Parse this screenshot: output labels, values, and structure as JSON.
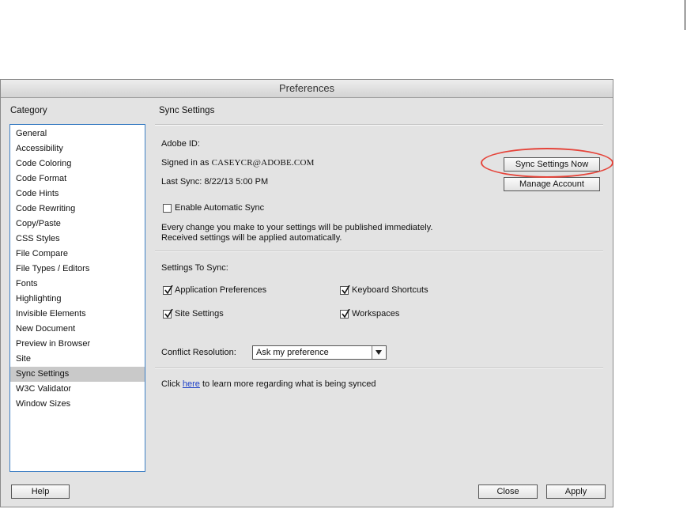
{
  "window": {
    "title": "Preferences"
  },
  "category": {
    "label": "Category",
    "items": [
      "General",
      "Accessibility",
      "Code Coloring",
      "Code Format",
      "Code Hints",
      "Code Rewriting",
      "Copy/Paste",
      "CSS Styles",
      "File Compare",
      "File Types / Editors",
      "Fonts",
      "Highlighting",
      "Invisible Elements",
      "New Document",
      "Preview in Browser",
      "Site",
      "Sync Settings",
      "W3C Validator",
      "Window Sizes"
    ],
    "selected": "Sync Settings"
  },
  "sync": {
    "title": "Sync Settings",
    "adobe_id_label": "Adobe ID:",
    "signed_in_prefix": "Signed in as",
    "email": "CASEYCR@ADOBE.COM",
    "last_sync": "Last Sync: 8/22/13 5:00 PM",
    "sync_now_button": "Sync Settings Now",
    "manage_account_button": "Manage Account",
    "enable_auto_sync": {
      "label": "Enable Automatic Sync",
      "checked": false
    },
    "info_line1": "Every change you make to your settings will be published immediately.",
    "info_line2": "Received settings will be applied automatically.",
    "settings_to_sync_label": "Settings To Sync:",
    "options": {
      "app_prefs": {
        "label": "Application Preferences",
        "checked": true
      },
      "keyboard": {
        "label": "Keyboard Shortcuts",
        "checked": true
      },
      "site": {
        "label": "Site Settings",
        "checked": true
      },
      "workspaces": {
        "label": "Workspaces",
        "checked": true
      }
    },
    "conflict_label": "Conflict Resolution:",
    "conflict_value": "Ask my preference",
    "learn_prefix": "Click",
    "learn_link": "here",
    "learn_suffix": "to learn more regarding what is being synced"
  },
  "footer": {
    "help": "Help",
    "close": "Close",
    "apply": "Apply"
  },
  "colors": {
    "highlight_ring": "#e5443a",
    "list_border": "#3d7fc4",
    "link": "#1b3ec7"
  }
}
